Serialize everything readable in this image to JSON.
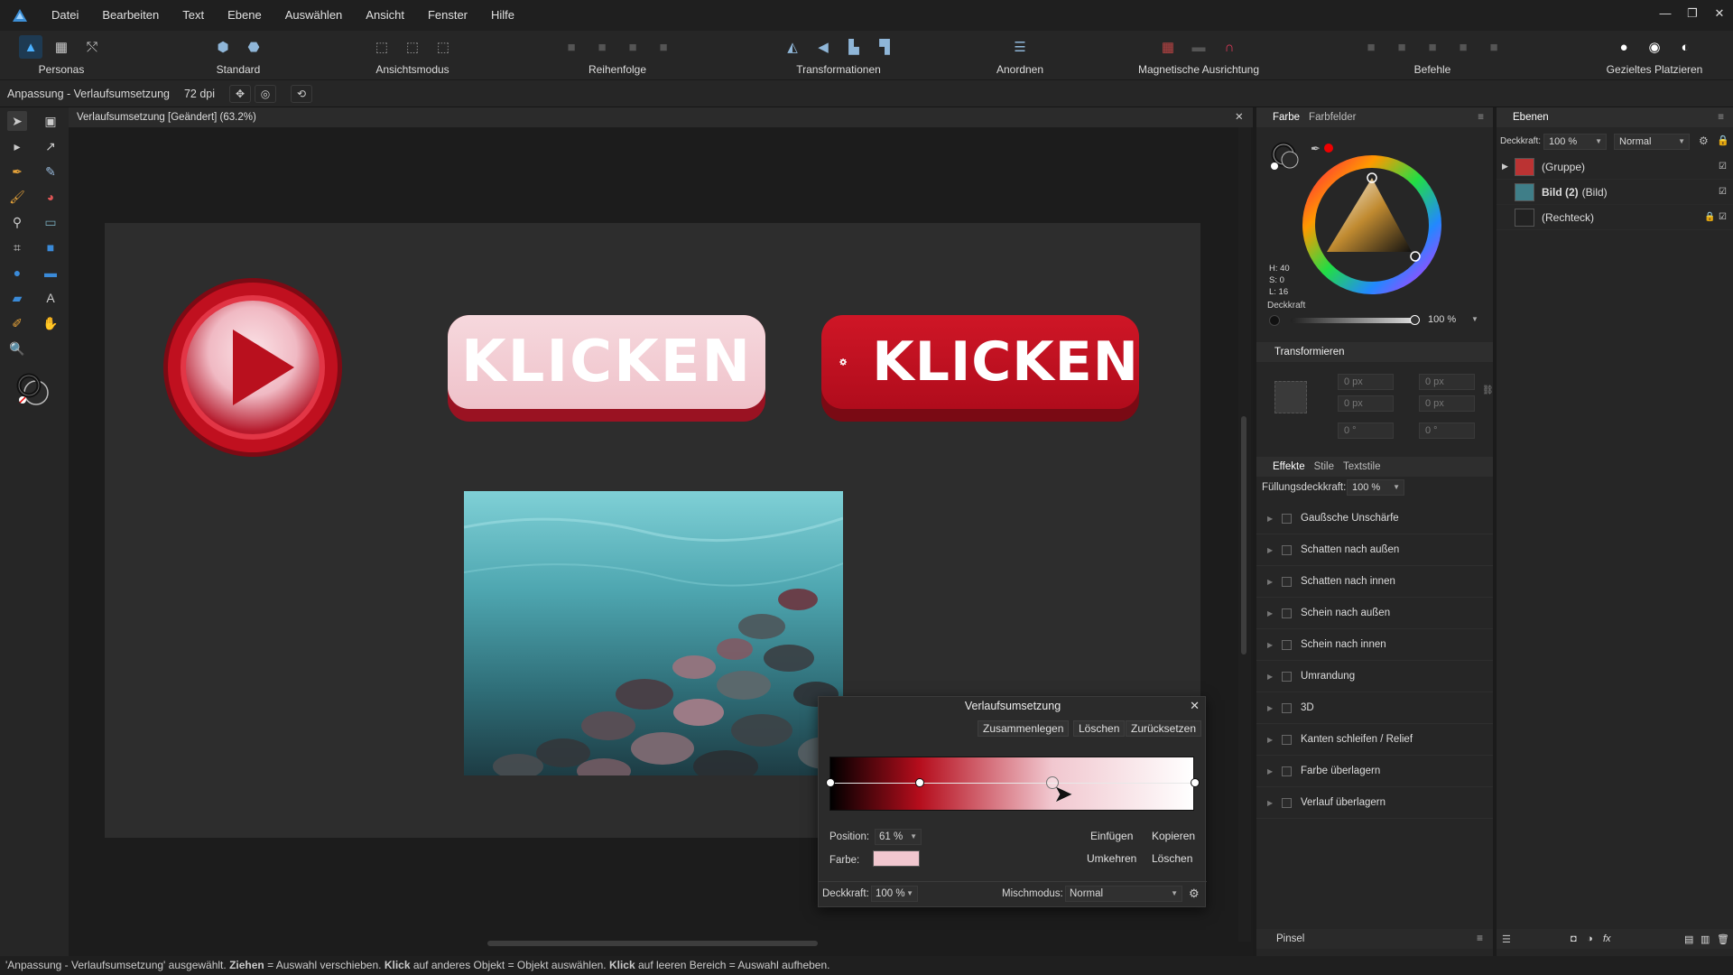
{
  "menu": [
    "Datei",
    "Bearbeiten",
    "Text",
    "Ebene",
    "Auswählen",
    "Ansicht",
    "Fenster",
    "Hilfe"
  ],
  "toolbar": {
    "personas": "Personas",
    "standard": "Standard",
    "view_mode": "Ansichtsmodus",
    "order": "Reihenfolge",
    "transformations": "Transformationen",
    "arrange": "Anordnen",
    "snapping": "Magnetische Ausrichtung",
    "commands": "Befehle",
    "placement": "Gezieltes Platzieren"
  },
  "context": {
    "title": "Anpassung - Verlaufsumsetzung",
    "dpi": "72 dpi"
  },
  "document": {
    "tab_title": "Verlaufsumsetzung [Geändert] (63.2%)"
  },
  "canvas": {
    "button1_text": "KLICKEN",
    "button2_text": "KLICKEN"
  },
  "colors": {
    "accent_red": "#b50d1c",
    "light_pink": "#f1c7cf",
    "button_pink": "#f2cbd2"
  },
  "color_panel": {
    "tabs": [
      "Farbe",
      "Farbfelder"
    ],
    "h": "H: 40",
    "s": "S: 0",
    "l": "L: 16",
    "opacity_label": "Deckkraft",
    "opacity_value": "100 %",
    "opacity_level": 1.0
  },
  "transform_panel": {
    "title": "Transformieren",
    "x": "0 px",
    "y": "0 px",
    "w": "0 px",
    "h": "0 px",
    "r": "0 °",
    "s": "0 °"
  },
  "effects_panel": {
    "tabs": [
      "Effekte",
      "Stile",
      "Textstile"
    ],
    "fill_opacity_label": "Füllungsdeckkraft:",
    "fill_opacity_value": "100 %",
    "effects": [
      "Gaußsche Unschärfe",
      "Schatten nach außen",
      "Schatten nach innen",
      "Schein nach außen",
      "Schein nach innen",
      "Umrandung",
      "3D",
      "Kanten schleifen / Relief",
      "Farbe überlagern",
      "Verlauf überlagern"
    ]
  },
  "brush_panel": {
    "title": "Pinsel"
  },
  "layers_panel": {
    "title": "Ebenen",
    "opacity_label": "Deckkraft:",
    "opacity_value": "100 %",
    "blend": "Normal",
    "layers": [
      {
        "name": "(Gruppe)",
        "bold": ""
      },
      {
        "name": "(Bild)",
        "bold": "Bild (2)"
      },
      {
        "name": "(Rechteck)",
        "bold": ""
      }
    ]
  },
  "gradient_map": {
    "title": "Verlaufsumsetzung",
    "btn_merge": "Zusammenlegen",
    "btn_delete": "Löschen",
    "btn_reset": "Zurücksetzen",
    "position_label": "Position:",
    "position_value": "61 %",
    "color_label": "Farbe:",
    "color_value": "#f1c7cf",
    "btn_insert": "Einfügen",
    "btn_copy": "Kopieren",
    "btn_reverse": "Umkehren",
    "btn_delete2": "Löschen",
    "opacity_label": "Deckkraft:",
    "opacity_value": "100 %",
    "blend_label": "Mischmodus:",
    "blend_value": "Normal",
    "stops": [
      0,
      0.245,
      0.61,
      1.0
    ]
  },
  "status": {
    "p1": "'Anpassung - Verlaufsumsetzung' ausgewählt. ",
    "b1": "Ziehen",
    "p2": " = Auswahl verschieben. ",
    "b2": "Klick",
    "p3": " auf anderes Objekt = Objekt auswählen. ",
    "b3": "Klick",
    "p4": " auf leeren Bereich = Auswahl aufheben."
  }
}
